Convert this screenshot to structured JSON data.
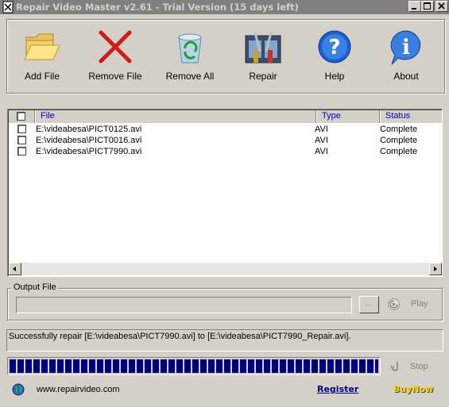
{
  "window": {
    "title": "Repair Video Master v2.61 - Trial Version (15 days left)"
  },
  "toolbar": {
    "buttons": [
      {
        "label": "Add File",
        "icon": "folder-icon"
      },
      {
        "label": "Remove File",
        "icon": "red-x-icon"
      },
      {
        "label": "Remove All",
        "icon": "recycle-bin-icon"
      },
      {
        "label": "Repair",
        "icon": "film-tools-icon"
      },
      {
        "label": "Help",
        "icon": "help-question-icon"
      },
      {
        "label": "About",
        "icon": "info-icon"
      }
    ]
  },
  "file_list": {
    "columns": [
      "File",
      "Type",
      "Status"
    ],
    "rows": [
      {
        "file": "E:\\videabesa\\PICT0125.avi",
        "type": "AVI",
        "status": "Complete"
      },
      {
        "file": "E:\\videabesa\\PICT0016.avi",
        "type": "AVI",
        "status": "Complete"
      },
      {
        "file": "E:\\videabesa\\PICT7990.avi",
        "type": "AVI",
        "status": "Complete"
      }
    ]
  },
  "output": {
    "group_label": "Output File",
    "value": "",
    "browse_label": "...",
    "play_label": "Play"
  },
  "status": {
    "message": "Successfully repair [E:\\videabesa\\PICT7990.avi] to [E:\\videabesa\\PICT7990_Repair.avi]."
  },
  "progress": {
    "fraction": 1.0,
    "stop_label": "Stop"
  },
  "footer": {
    "website": "www.repairvideo.com",
    "register_label": "Register",
    "buynow_label": "BuyNow"
  },
  "colors": {
    "title_bar": "#808080",
    "face": "#d4d0c8",
    "header_text": "#0000c0",
    "progress": "#00007f",
    "register": "#000080",
    "buynow": "#ffd700"
  }
}
